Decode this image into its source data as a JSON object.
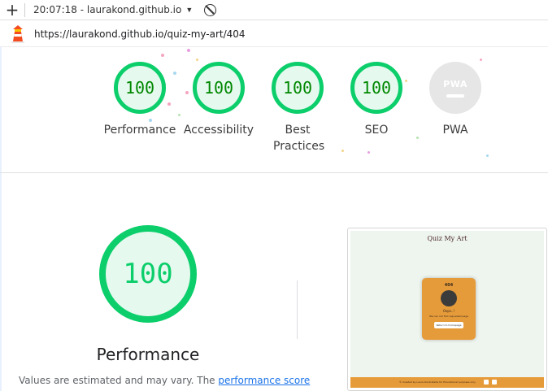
{
  "toolbar": {
    "new_tab_icon": "plus-icon",
    "report_label": "20:07:18 - laurakond.github.io",
    "dropdown_icon": "caret-down-icon",
    "block_icon": "block-icon"
  },
  "urlbar": {
    "logo_icon": "lighthouse-icon",
    "url": "https://laurakond.github.io/quiz-my-art/404"
  },
  "scores": [
    {
      "label": "Performance",
      "score": "100"
    },
    {
      "label": "Accessibility",
      "score": "100"
    },
    {
      "label": "Best Practices",
      "score": "100"
    },
    {
      "label": "SEO",
      "score": "100"
    },
    {
      "label": "PWA",
      "score": "PWA"
    }
  ],
  "performance": {
    "score": "100",
    "title": "Performance",
    "note_prefix": "Values are estimated and may vary. The ",
    "note_link": "performance score"
  },
  "screenshot": {
    "site_title": "Quiz My Art",
    "card_heading": "404",
    "card_oops": "Oops..!",
    "card_message": "We can not find requested page",
    "card_button": "Return to homepage",
    "footer_text": "© Created by Laura Kondrataite for Educational purposes only"
  },
  "colors": {
    "pass_green": "#0cce6b",
    "pass_text": "#008800",
    "pass_bg": "#e6f9ef",
    "link_blue": "#1a73e8",
    "site_orange": "#e69b3a"
  }
}
